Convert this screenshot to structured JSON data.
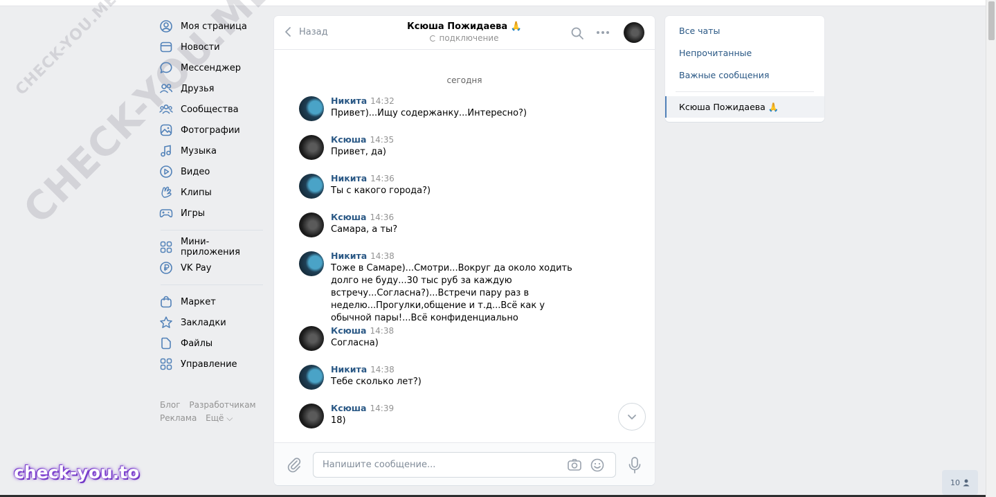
{
  "watermark": {
    "small": "CHECK-YOU.ME",
    "big": "CHECK-YOU.ME",
    "brand": "check-you.to"
  },
  "nav": {
    "items": [
      {
        "label": "Моя страница",
        "icon": "user-icon"
      },
      {
        "label": "Новости",
        "icon": "news-icon"
      },
      {
        "label": "Мессенджер",
        "icon": "message-icon"
      },
      {
        "label": "Друзья",
        "icon": "friends-icon"
      },
      {
        "label": "Сообщества",
        "icon": "groups-icon"
      },
      {
        "label": "Фотографии",
        "icon": "photo-icon"
      },
      {
        "label": "Музыка",
        "icon": "music-icon"
      },
      {
        "label": "Видео",
        "icon": "video-icon"
      },
      {
        "label": "Клипы",
        "icon": "clips-icon"
      },
      {
        "label": "Игры",
        "icon": "games-icon"
      }
    ],
    "items2": [
      {
        "label": "Мини-приложения",
        "icon": "apps-icon"
      },
      {
        "label": "VK Pay",
        "icon": "vkpay-icon"
      }
    ],
    "items3": [
      {
        "label": "Маркет",
        "icon": "market-icon"
      },
      {
        "label": "Закладки",
        "icon": "star-icon"
      },
      {
        "label": "Файлы",
        "icon": "file-icon"
      },
      {
        "label": "Управление",
        "icon": "manage-icon"
      }
    ],
    "footer": {
      "blog": "Блог",
      "dev": "Разработчикам",
      "ads": "Реклама",
      "more": "Ещё ⌵"
    }
  },
  "chat": {
    "back_label": "Назад",
    "peer_name": "Ксюша Пожидаева 🙏",
    "peer_status": "подключение",
    "day_label": "сегодня",
    "messages": [
      {
        "author": "Никита",
        "time": "14:32",
        "text": "Привет)...Ищу содержанку...Интересно?)",
        "avatar": "n"
      },
      {
        "author": "Ксюша",
        "time": "14:35",
        "text": "Привет, да)",
        "avatar": "k"
      },
      {
        "author": "Никита",
        "time": "14:36",
        "text": "Ты с какого города?)",
        "avatar": "n"
      },
      {
        "author": "Ксюша",
        "time": "14:36",
        "text": "Самара, а ты?",
        "avatar": "k"
      },
      {
        "author": "Никита",
        "time": "14:38",
        "text": "Тоже в Самаре)...Смотри...Вокруг да около ходить долго не буду...30 тыс руб за каждую встречу...Согласна?)...Встречи пару раз в неделю...Прогулки,общение и т.д...Всё как у обычной пары!...Всё конфиденциально",
        "avatar": "n"
      },
      {
        "author": "Ксюша",
        "time": "14:38",
        "text": "Согласна)",
        "avatar": "k"
      },
      {
        "author": "Никита",
        "time": "14:38",
        "text": "Тебе сколько лет?)",
        "avatar": "n"
      },
      {
        "author": "Ксюша",
        "time": "14:39",
        "text": "18)",
        "avatar": "k"
      }
    ],
    "composer_placeholder": "Напишите сообщение..."
  },
  "filters": {
    "all": "Все чаты",
    "unread": "Непрочитанные",
    "important": "Важные сообщения",
    "active_chat": "Ксюша Пожидаева 🙏"
  },
  "online": {
    "count": "10"
  }
}
